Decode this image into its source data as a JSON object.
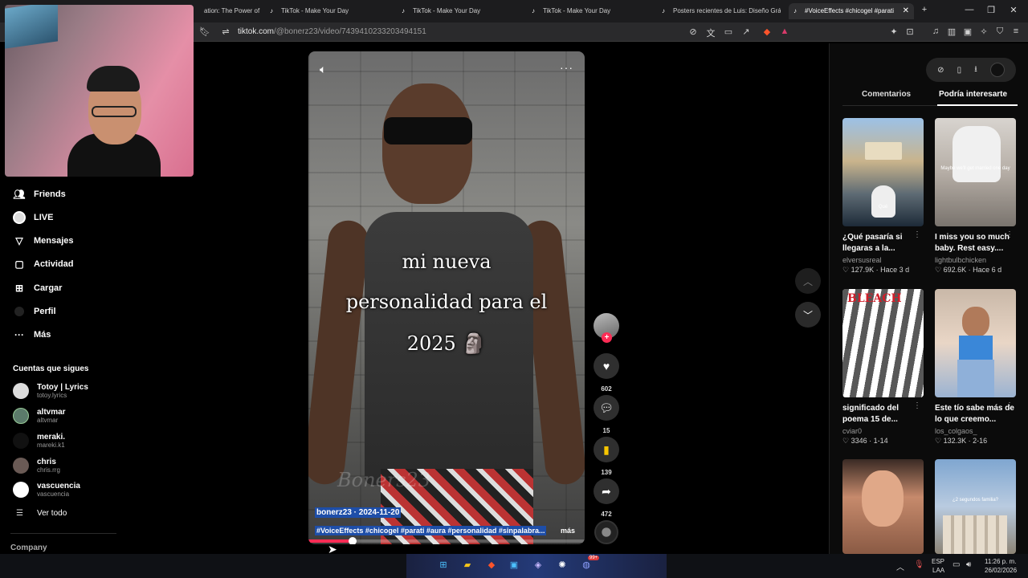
{
  "browser": {
    "tabs": [
      {
        "label": "ation: The Power of E"
      },
      {
        "label": "TikTok - Make Your Day"
      },
      {
        "label": "TikTok - Make Your Day"
      },
      {
        "label": "TikTok - Make Your Day"
      },
      {
        "label": "Posters recientes de Luis: Diseño Grá"
      },
      {
        "label": "#VoiceEffects #chicogel #parati"
      }
    ],
    "new_tab": "+",
    "url_host": "tiktok.com",
    "url_path": "/@bonerz23/video/7439410233203494151"
  },
  "sidebar": {
    "nav": [
      {
        "label": "Friends",
        "icon": "friends-icon"
      },
      {
        "label": "LIVE",
        "icon": "live-icon"
      },
      {
        "label": "Mensajes",
        "icon": "messages-icon"
      },
      {
        "label": "Actividad",
        "icon": "activity-icon"
      },
      {
        "label": "Cargar",
        "icon": "upload-icon"
      },
      {
        "label": "Perfil",
        "icon": "profile-icon"
      },
      {
        "label": "Más",
        "icon": "more-icon"
      }
    ],
    "following_title": "Cuentas que sigues",
    "accounts": [
      {
        "name": "Totoy | Lyrics",
        "handle": "totoy.lyrics"
      },
      {
        "name": "altvmar",
        "handle": "altvmar"
      },
      {
        "name": "meraki.",
        "handle": "mareki.k1"
      },
      {
        "name": "chris",
        "handle": "chris.rrg"
      },
      {
        "name": "vascuencia",
        "handle": "vascuencia"
      }
    ],
    "see_all": "Ver todo",
    "company": "Company"
  },
  "video": {
    "caption_lines": [
      "mi nueva",
      "personalidad para el",
      "2025 🗿"
    ],
    "watermark": "Boners23",
    "author_date": "bonerz23 · 2024-11-20",
    "hashtags": "#VoiceEffects #chicogel #parati #aura #personalidad #sinpalabra...",
    "more": "más",
    "progress": 0.16
  },
  "actions": {
    "likes": "602",
    "comments": "15",
    "saves": "139",
    "shares": "472"
  },
  "right_panel": {
    "tab_comments": "Comentarios",
    "tab_suggested": "Podría interesarte",
    "cards": [
      {
        "title": "¿Qué pasaría si llegaras a la...",
        "author": "elversusreal",
        "stats": "♡ 127.9K · Hace 3 d",
        "thumb_text": "Qué"
      },
      {
        "title": "I miss you so much baby. Rest easy....",
        "author": "lightbulbchicken",
        "stats": "♡ 692.6K · Hace 6 d",
        "thumb_text": "Maybe we'll get married one day"
      },
      {
        "title": "significado del poema 15 de...",
        "author": "cviar0",
        "stats": "♡ 3346 · 1-14",
        "thumb_text": "BLEACH"
      },
      {
        "title": "Este tío sabe más de lo que creemo...",
        "author": "los_colgaos_",
        "stats": "♡ 132.3K · 2-16",
        "thumb_text": ""
      },
      {
        "title": "",
        "author": "",
        "stats": "",
        "thumb_text": ""
      },
      {
        "title": "",
        "author": "",
        "stats": "",
        "thumb_text": "¿2 segundos familia?"
      }
    ]
  },
  "taskbar": {
    "lang": "ESP",
    "lang2": "LAA",
    "time": "11:26 p. m.",
    "date": "26/02/2026",
    "discord_badge": "99+"
  },
  "colors": {
    "accent": "#fe2c55",
    "save_yellow": "#f7c600",
    "highlight_blue": "#1e4ea8"
  }
}
